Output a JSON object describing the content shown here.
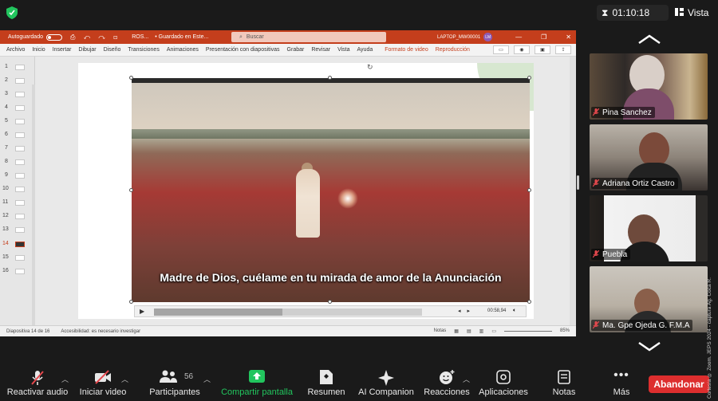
{
  "meeting": {
    "timer": "01:10:18",
    "view_label": "Vista"
  },
  "powerpoint": {
    "autosave_label": "Autoguardado",
    "doc_title": "ROS...",
    "save_status": "• Guardado en Este...",
    "search_placeholder": "Buscar",
    "user_label": "LAPTOP_MW00001",
    "user_initials": "LM",
    "menu": [
      "Archivo",
      "Inicio",
      "Insertar",
      "Dibujar",
      "Diseño",
      "Transiciones",
      "Animaciones",
      "Presentación con diapositivas",
      "Grabar",
      "Revisar",
      "Vista",
      "Ayuda"
    ],
    "context_tabs": [
      "Formato de video",
      "Reproducción"
    ],
    "slide_numbers": [
      "1",
      "2",
      "3",
      "4",
      "5",
      "6",
      "7",
      "8",
      "9",
      "10",
      "11",
      "12",
      "13",
      "14",
      "15",
      "16"
    ],
    "active_slide": "14",
    "video_subtitle": "Madre de Dios, cuélame en tu mirada de amor de la Anunciación",
    "video_time": "00:58,94",
    "video_progress": 0.48,
    "status_slide": "Diapositiva 14 de 16",
    "status_accessibility": "Accesibilidad: es necesario investigar",
    "status_notes": "Notas",
    "zoom": "85%"
  },
  "participants": [
    {
      "name": "Pina Sanchez",
      "muted": true
    },
    {
      "name": "Adriana Ortiz Castro",
      "muted": true
    },
    {
      "name": "Puebla",
      "muted": true
    },
    {
      "name": "Ma. Gpe Ojeda G. F.M.A",
      "muted": true
    }
  ],
  "toolbar": {
    "unmute": "Reactivar audio",
    "start_video": "Iniciar video",
    "participants": "Participantes",
    "participants_count": "56",
    "share_screen": "Compartir pantalla",
    "summary": "Resumen",
    "ai_companion": "AI Companion",
    "reactions": "Reacciones",
    "apps": "Aplicaciones",
    "notes": "Notas",
    "more": "Más",
    "leave": "Abandonar"
  },
  "watermark": "Cortesía ® Zoom. JEPS 2024 - captura Ag. Coca R.",
  "colors": {
    "ppt_red": "#c43e1c",
    "share_green": "#22c55e",
    "leave_red": "#dd2e2e",
    "muted_red": "#e5484d"
  }
}
